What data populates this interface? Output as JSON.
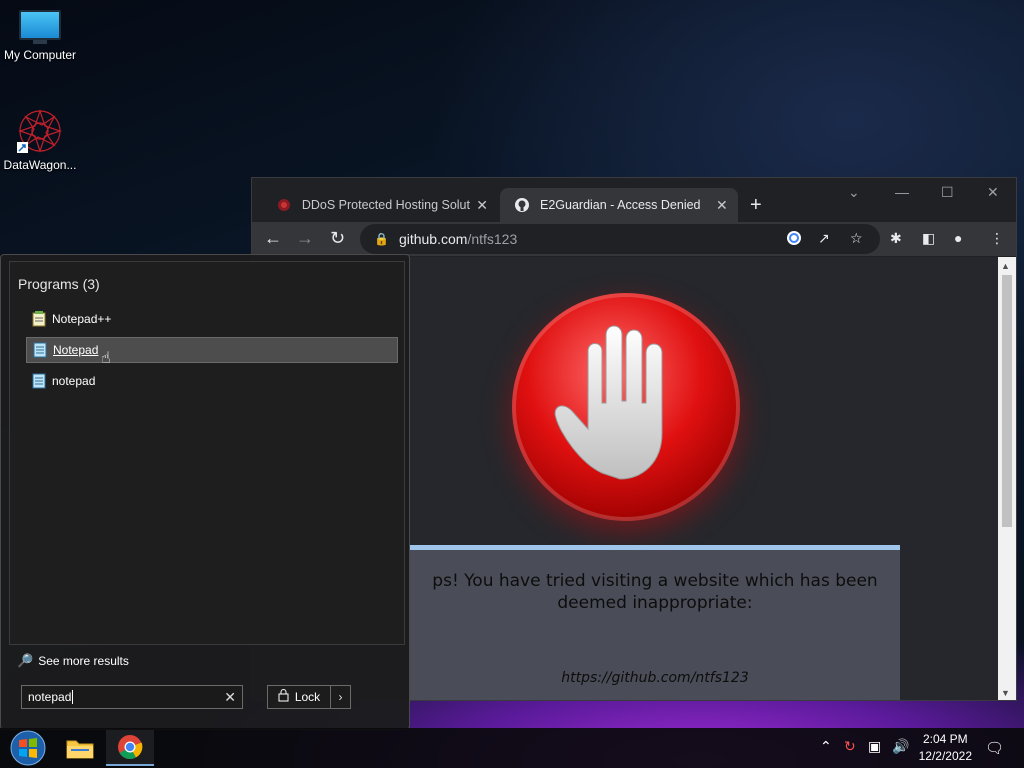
{
  "desktop": {
    "icons": [
      {
        "label": "My Computer",
        "icon": "monitor-icon"
      },
      {
        "label": "DataWagon...",
        "icon": "star-shortcut-icon"
      }
    ]
  },
  "browser": {
    "tabs": [
      {
        "title": "DDoS Protected Hosting Solution",
        "icon": "ddos-site-icon",
        "active": false,
        "close": "✕"
      },
      {
        "title": "E2Guardian - Access Denied",
        "icon": "github-icon",
        "active": true,
        "close": "✕"
      }
    ],
    "new_tab": "+",
    "address": {
      "domain": "github.com",
      "path": "/ntfs123"
    },
    "page": {
      "message": "ps! You have tried visiting a website which has been deemed inappropriate:",
      "blocked_url": "https://github.com/ntfs123"
    }
  },
  "start_menu": {
    "programs_header": "Programs (3)",
    "programs": [
      {
        "label": "Notepad++",
        "icon": "notepadpp-icon",
        "hover": false
      },
      {
        "label": "Notepad",
        "icon": "notepad-icon",
        "hover": true
      },
      {
        "label": "notepad",
        "icon": "notepad-icon",
        "hover": false
      }
    ],
    "see_more": "See more results",
    "search": {
      "value": "notepad",
      "clear": "✕"
    },
    "lock_label": "Lock"
  },
  "taskbar": {
    "time": "2:04 PM",
    "date": "12/2/2022"
  },
  "colors": {
    "chrome_bg": "#202124",
    "chrome_toolbar": "#35363a",
    "stop_red": "#e01010",
    "message_bg": "#4a4d57",
    "message_border": "#9fc6ea"
  }
}
